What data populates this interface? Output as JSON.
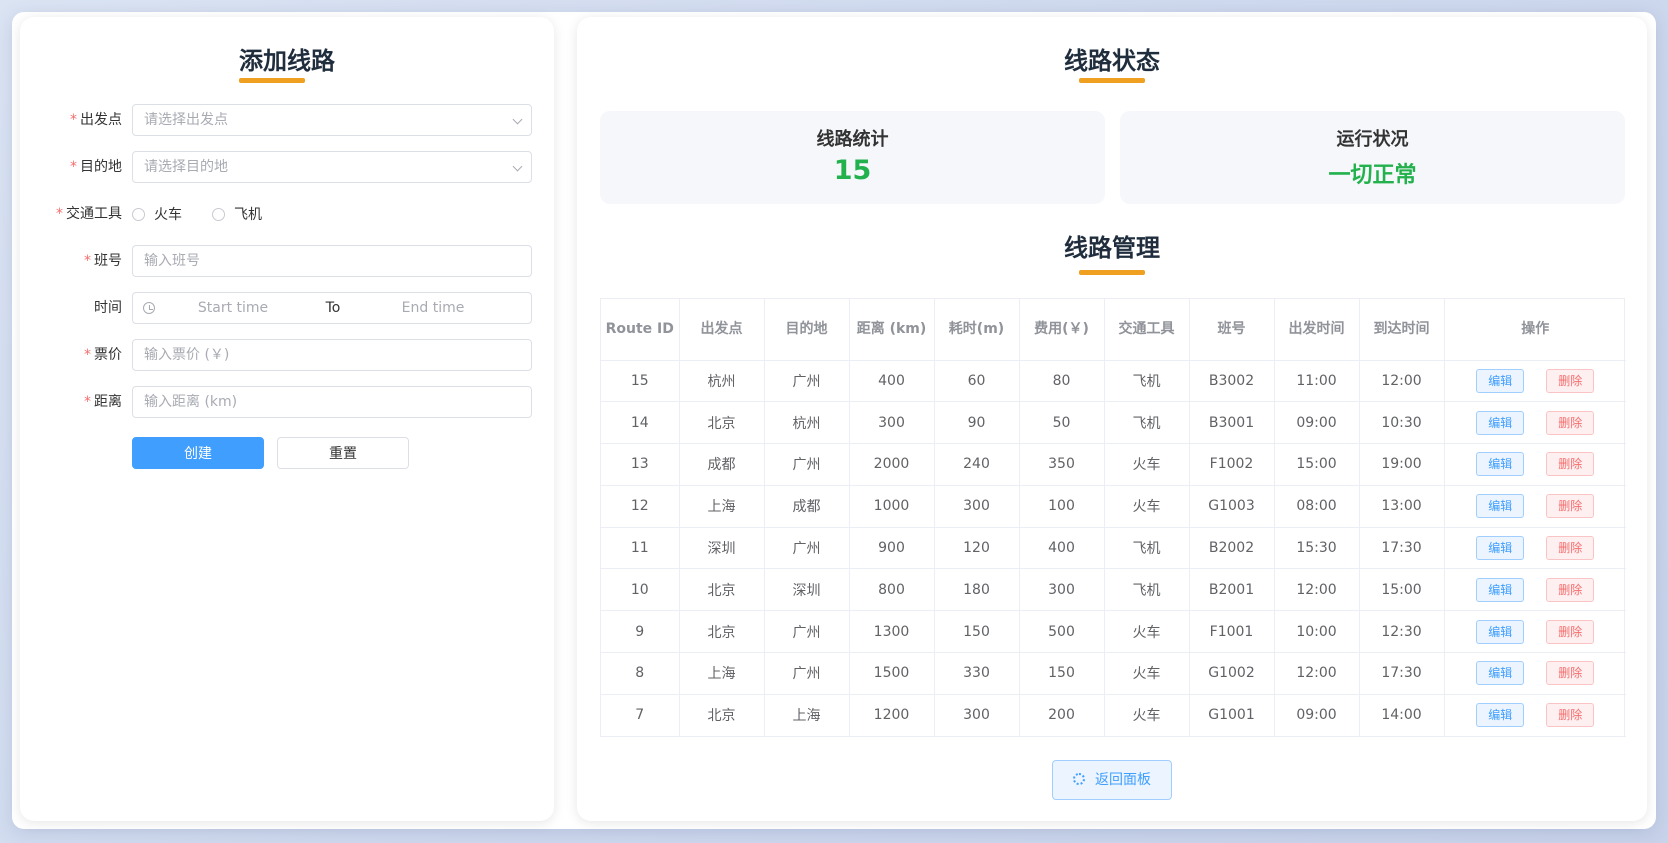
{
  "left": {
    "title": "添加线路",
    "fields": {
      "origin": {
        "label": "出发点",
        "placeholder": "请选择出发点"
      },
      "destination": {
        "label": "目的地",
        "placeholder": "请选择目的地"
      },
      "transport": {
        "label": "交通工具",
        "options": [
          "火车",
          "飞机"
        ]
      },
      "number": {
        "label": "班号",
        "placeholder": "输入班号"
      },
      "time": {
        "label": "时间",
        "start": "Start time",
        "sep": "To",
        "end": "End time"
      },
      "price": {
        "label": "票价",
        "placeholder": "输入票价 (￥)"
      },
      "distance": {
        "label": "距离",
        "placeholder": "输入距离 (km)"
      }
    },
    "required_mark": "*",
    "buttons": {
      "create": "创建",
      "reset": "重置"
    }
  },
  "right": {
    "title": "线路状态",
    "stats": {
      "routes_label": "线路统计",
      "routes_value": "15",
      "status_label": "运行状况",
      "status_value": "一切正常"
    },
    "manage_title": "线路管理",
    "table": {
      "headers": [
        "Route ID",
        "出发点",
        "目的地",
        "距离 (km)",
        "耗时(m)",
        "费用(￥)",
        "交通工具",
        "班号",
        "出发时间",
        "到达时间",
        "操作"
      ],
      "rows": [
        [
          "15",
          "杭州",
          "广州",
          "400",
          "60",
          "80",
          "飞机",
          "B3002",
          "11:00",
          "12:00"
        ],
        [
          "14",
          "北京",
          "杭州",
          "300",
          "90",
          "50",
          "飞机",
          "B3001",
          "09:00",
          "10:30"
        ],
        [
          "13",
          "成都",
          "广州",
          "2000",
          "240",
          "350",
          "火车",
          "F1002",
          "15:00",
          "19:00"
        ],
        [
          "12",
          "上海",
          "成都",
          "1000",
          "300",
          "100",
          "火车",
          "G1003",
          "08:00",
          "13:00"
        ],
        [
          "11",
          "深圳",
          "广州",
          "900",
          "120",
          "400",
          "飞机",
          "B2002",
          "15:30",
          "17:30"
        ],
        [
          "10",
          "北京",
          "深圳",
          "800",
          "180",
          "300",
          "飞机",
          "B2001",
          "12:00",
          "15:00"
        ],
        [
          "9",
          "北京",
          "广州",
          "1300",
          "150",
          "500",
          "火车",
          "F1001",
          "10:00",
          "12:30"
        ],
        [
          "8",
          "上海",
          "广州",
          "1500",
          "330",
          "150",
          "火车",
          "G1002",
          "12:00",
          "17:30"
        ],
        [
          "7",
          "北京",
          "上海",
          "1200",
          "300",
          "200",
          "火车",
          "G1001",
          "09:00",
          "14:00"
        ]
      ],
      "edit_label": "编辑",
      "delete_label": "删除"
    },
    "back_button": "返回面板"
  },
  "colors": {
    "primary": "#409eff",
    "accent_bar": "#f0a020",
    "success": "#22b14c",
    "danger": "#f56c6c"
  }
}
